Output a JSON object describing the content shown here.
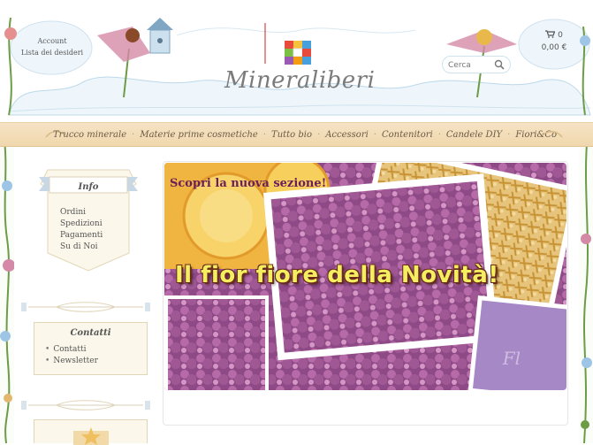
{
  "header": {
    "account_label": "Account",
    "wishlist_label": "Lista dei desideri",
    "logo_text": "Mineraliberi",
    "search": {
      "placeholder": "Cerca"
    },
    "cart": {
      "count": "0",
      "total": "0,00 €",
      "icon": "cart-icon"
    }
  },
  "nav": {
    "items": [
      "Trucco minerale",
      "Materie prime cosmetiche",
      "Tutto bio",
      "Accessori",
      "Contenitori",
      "Candele DIY",
      "Fiori&Co"
    ],
    "separator": "·"
  },
  "sidebar": {
    "info": {
      "title": "Info",
      "links": [
        "Ordini",
        "Spedizioni",
        "Pagamenti",
        "Su di Noi"
      ]
    },
    "contatti": {
      "title": "Contatti",
      "links": [
        "Contatti",
        "Newsletter"
      ]
    }
  },
  "banner": {
    "top_text": "Scopri la nuova sezione!",
    "main_text": "Il fior fiore della Novità!",
    "watermark": "Fl"
  },
  "colors": {
    "nav_bg": "#f0d7ad",
    "accent_purple": "#6a1f5a",
    "banner_text": "#f4ee61"
  }
}
